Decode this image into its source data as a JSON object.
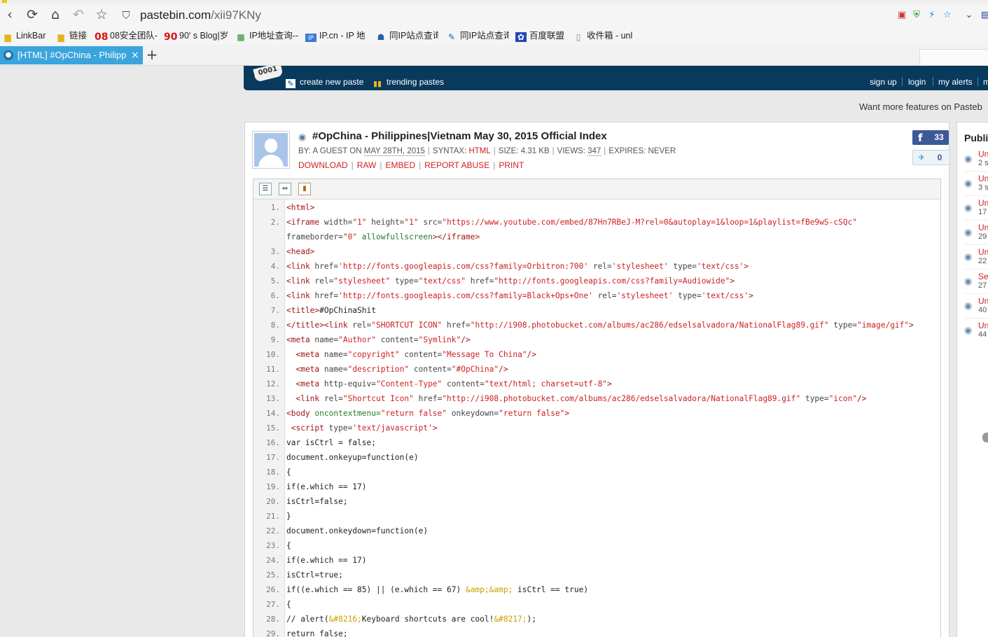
{
  "browser": {
    "address": {
      "host": "pastebin.com",
      "path": "/xii97KNy"
    },
    "nav_icons": [
      "back-icon",
      "reload-icon",
      "home-icon",
      "undo-icon",
      "star-icon"
    ],
    "bookmarks": [
      {
        "label": "LinkBar",
        "icon": "folder-icon"
      },
      {
        "label": "链接",
        "icon": "folder-icon"
      },
      {
        "label": "08安全团队-",
        "icon": "08-icon",
        "badge": "08"
      },
      {
        "label": "90' s Blog|岁",
        "icon": "90-icon",
        "badge": "90"
      },
      {
        "label": "IP地址查询--",
        "icon": "ip-query-icon"
      },
      {
        "label": "IP.cn - IP 地",
        "icon": "ipcn-icon"
      },
      {
        "label": "同IP站点查询",
        "icon": "same-ip-icon"
      },
      {
        "label": "同IP站点查询",
        "icon": "same-ip-icon-2"
      },
      {
        "label": "百度联盟",
        "icon": "baidu-icon"
      },
      {
        "label": "收件箱 - unl",
        "icon": "page-icon"
      }
    ],
    "tab": {
      "label": "[HTML] #OpChina - Philippi",
      "close": "×"
    },
    "new_tab": "+"
  },
  "site": {
    "logo_text": "0001",
    "nav": {
      "create": "create new paste",
      "trending": "trending pastes",
      "sign_up": "sign up",
      "login": "login",
      "alerts": "my alerts",
      "more": "m"
    },
    "promo": "Want more features on Pasteb"
  },
  "paste": {
    "title": "#OpChina - Philippines|Vietnam May 30, 2015 Official Index",
    "meta": {
      "by": "BY: A GUEST ON ",
      "date": "MAY 28TH, 2015",
      "syntax_label": "SYNTAX: ",
      "syntax": "HTML",
      "size": "SIZE: 4.31 KB",
      "views_label": "VIEWS: ",
      "views": "347",
      "expires": "EXPIRES: NEVER"
    },
    "actions": [
      "DOWNLOAD",
      "RAW",
      "EMBED",
      "REPORT ABUSE",
      "PRINT"
    ],
    "facebook_count": "33",
    "twitter_count": "0",
    "lines": [
      {
        "n": "1.",
        "spans": [
          [
            "#a31515",
            "<html>"
          ]
        ]
      },
      {
        "n": "2.",
        "spans": [
          [
            "#a31515",
            "<iframe "
          ],
          [
            "#444",
            "width="
          ],
          [
            "#c22",
            "\"1\" "
          ],
          [
            "#444",
            "height="
          ],
          [
            "#c22",
            "\"1\" "
          ],
          [
            "#444",
            "src="
          ],
          [
            "#c22",
            "\"https://www.youtube.com/embed/87Hn7RBeJ-M?rel=0&autoplay=1&loop=1&playlist=fBe9wS-cSQc\""
          ]
        ]
      },
      {
        "n": "",
        "spans": [
          [
            "#444",
            "frameborder="
          ],
          [
            "#c22",
            "\"0\" "
          ],
          [
            "#2a7a2a",
            "allowfullscreen"
          ],
          [
            "#a31515",
            "></iframe>"
          ]
        ]
      },
      {
        "n": "3.",
        "spans": [
          [
            "#a31515",
            "<head>"
          ]
        ]
      },
      {
        "n": "4.",
        "spans": [
          [
            "#a31515",
            "<link "
          ],
          [
            "#444",
            "href="
          ],
          [
            "#c22",
            "'http://fonts.googleapis.com/css?family=Orbitron:700' "
          ],
          [
            "#444",
            "rel="
          ],
          [
            "#c22",
            "'stylesheet' "
          ],
          [
            "#444",
            "type="
          ],
          [
            "#c22",
            "'text/css'"
          ],
          [
            "#a31515",
            ">"
          ]
        ]
      },
      {
        "n": "5.",
        "spans": [
          [
            "#a31515",
            "<link "
          ],
          [
            "#444",
            "rel="
          ],
          [
            "#c22",
            "\"stylesheet\" "
          ],
          [
            "#444",
            "type="
          ],
          [
            "#c22",
            "\"text/css\" "
          ],
          [
            "#444",
            "href="
          ],
          [
            "#c22",
            "\"http://fonts.googleapis.com/css?family=Audiowide\""
          ],
          [
            "#a31515",
            ">"
          ]
        ]
      },
      {
        "n": "6.",
        "spans": [
          [
            "#a31515",
            "<link "
          ],
          [
            "#444",
            "href="
          ],
          [
            "#c22",
            "'http://fonts.googleapis.com/css?family=Black+Ops+One' "
          ],
          [
            "#444",
            "rel="
          ],
          [
            "#c22",
            "'stylesheet' "
          ],
          [
            "#444",
            "type="
          ],
          [
            "#c22",
            "'text/css'"
          ],
          [
            "#a31515",
            ">"
          ]
        ]
      },
      {
        "n": "7.",
        "spans": [
          [
            "#a31515",
            "<title>"
          ],
          [
            "#222",
            "#OpChinaShit"
          ]
        ]
      },
      {
        "n": "8.",
        "spans": [
          [
            "#a31515",
            "</title><link "
          ],
          [
            "#444",
            "rel="
          ],
          [
            "#c22",
            "\"SHORTCUT ICON\" "
          ],
          [
            "#444",
            "href="
          ],
          [
            "#c22",
            "\"http://i908.photobucket.com/albums/ac286/edselsalvadora/NationalFlag89.gif\" "
          ],
          [
            "#444",
            "type="
          ],
          [
            "#c22",
            "\"image/gif\""
          ],
          [
            "#a31515",
            ">"
          ]
        ]
      },
      {
        "n": "9.",
        "spans": [
          [
            "#a31515",
            "<meta "
          ],
          [
            "#444",
            "name="
          ],
          [
            "#c22",
            "\"Author\" "
          ],
          [
            "#444",
            "content="
          ],
          [
            "#c22",
            "\"Symlink\""
          ],
          [
            "#a31515",
            "/>"
          ]
        ]
      },
      {
        "n": "10.",
        "spans": [
          [
            "#a31515",
            "  <meta "
          ],
          [
            "#444",
            "name="
          ],
          [
            "#c22",
            "\"copyright\" "
          ],
          [
            "#444",
            "content="
          ],
          [
            "#c22",
            "\"Message To China\""
          ],
          [
            "#a31515",
            "/>"
          ]
        ]
      },
      {
        "n": "11.",
        "spans": [
          [
            "#a31515",
            "  <meta "
          ],
          [
            "#444",
            "name="
          ],
          [
            "#c22",
            "\"description\" "
          ],
          [
            "#444",
            "content="
          ],
          [
            "#c22",
            "\"#OpChina\""
          ],
          [
            "#a31515",
            "/>"
          ]
        ]
      },
      {
        "n": "12.",
        "spans": [
          [
            "#a31515",
            "  <meta "
          ],
          [
            "#444",
            "http-equiv="
          ],
          [
            "#c22",
            "\"Content-Type\" "
          ],
          [
            "#444",
            "content="
          ],
          [
            "#c22",
            "\"text/html; charset=utf-8\""
          ],
          [
            "#a31515",
            ">"
          ]
        ]
      },
      {
        "n": "13.",
        "spans": [
          [
            "#a31515",
            "  <link "
          ],
          [
            "#444",
            "rel="
          ],
          [
            "#c22",
            "\"Shortcut Icon\" "
          ],
          [
            "#444",
            "href="
          ],
          [
            "#c22",
            "\"http://i908.photobucket.com/albums/ac286/edselsalvadora/NationalFlag89.gif\" "
          ],
          [
            "#444",
            "type="
          ],
          [
            "#c22",
            "\"icon\""
          ],
          [
            "#a31515",
            "/>"
          ]
        ]
      },
      {
        "n": "14.",
        "spans": [
          [
            "#a31515",
            "<body "
          ],
          [
            "#2a7a2a",
            "oncontextmenu="
          ],
          [
            "#c22",
            "\"return false\" "
          ],
          [
            "#444",
            "onkeydown="
          ],
          [
            "#c22",
            "\"return false\""
          ],
          [
            "#a31515",
            ">"
          ]
        ]
      },
      {
        "n": "15.",
        "spans": [
          [
            "#a31515",
            " <script "
          ],
          [
            "#444",
            "type="
          ],
          [
            "#c22",
            "'text/javascript'"
          ],
          [
            "#a31515",
            ">"
          ]
        ]
      },
      {
        "n": "16.",
        "spans": [
          [
            "#222",
            "var isCtrl = false;"
          ]
        ]
      },
      {
        "n": "17.",
        "spans": [
          [
            "#222",
            "document.onkeyup=function(e)"
          ]
        ]
      },
      {
        "n": "18.",
        "spans": [
          [
            "#222",
            "{"
          ]
        ]
      },
      {
        "n": "19.",
        "spans": [
          [
            "#222",
            "if(e.which == 17)"
          ]
        ]
      },
      {
        "n": "20.",
        "spans": [
          [
            "#222",
            "isCtrl=false;"
          ]
        ]
      },
      {
        "n": "21.",
        "spans": [
          [
            "#222",
            "}"
          ]
        ]
      },
      {
        "n": "22.",
        "spans": [
          [
            "#222",
            "document.onkeydown=function(e)"
          ]
        ]
      },
      {
        "n": "23.",
        "spans": [
          [
            "#222",
            "{"
          ]
        ]
      },
      {
        "n": "24.",
        "spans": [
          [
            "#222",
            "if(e.which == 17)"
          ]
        ]
      },
      {
        "n": "25.",
        "spans": [
          [
            "#222",
            "isCtrl=true;"
          ]
        ]
      },
      {
        "n": "26.",
        "spans": [
          [
            "#222",
            "if((e.which == 85) || (e.which == 67) "
          ],
          [
            "#c9a000",
            "&amp;&amp;"
          ],
          [
            "#222",
            " isCtrl == true)"
          ]
        ]
      },
      {
        "n": "27.",
        "spans": [
          [
            "#222",
            "{"
          ]
        ]
      },
      {
        "n": "28.",
        "spans": [
          [
            "#222",
            "// alert("
          ],
          [
            "#c9a000",
            "&#8216;"
          ],
          [
            "#222",
            "Keyboard shortcuts are cool!"
          ],
          [
            "#c9a000",
            "&#8217;"
          ],
          [
            "#222",
            ");"
          ]
        ]
      },
      {
        "n": "29.",
        "spans": [
          [
            "#222",
            "return false;"
          ]
        ]
      }
    ]
  },
  "sidebar": {
    "title": "Publi",
    "items": [
      {
        "t": "Un",
        "s": "2 s"
      },
      {
        "t": "Un",
        "s": "3 s"
      },
      {
        "t": "Un",
        "s": "17"
      },
      {
        "t": "Un",
        "s": "29"
      },
      {
        "t": "Un",
        "s": "22"
      },
      {
        "t": "Se",
        "s": "27"
      },
      {
        "t": "Un",
        "s": "40"
      },
      {
        "t": "Un",
        "s": "44"
      }
    ]
  }
}
